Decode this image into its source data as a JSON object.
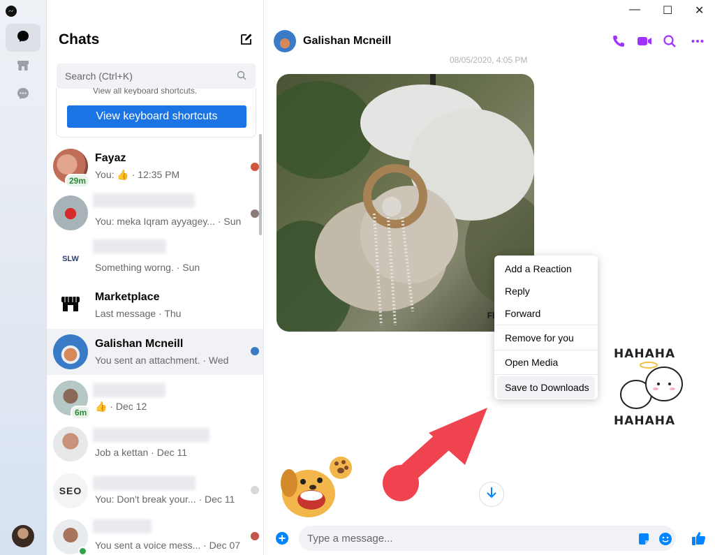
{
  "window": {
    "minimize": "—",
    "maximize": "☐",
    "close": "✕"
  },
  "list": {
    "title": "Chats",
    "search_placeholder": "Search (Ctrl+K)",
    "tip_text": "View all keyboard shortcuts.",
    "tip_button": "View keyboard shortcuts",
    "chats": [
      {
        "name": "Fayaz",
        "preview": "You: 👍 · 12:35 PM",
        "badge": "29m"
      },
      {
        "name": "",
        "preview": "You: meka Iqram ayyagey... · Sun"
      },
      {
        "name": "",
        "preview": "Something worng. · Sun",
        "logo": "SLW"
      },
      {
        "name": "Marketplace",
        "preview": "Last message · Thu"
      },
      {
        "name": "Galishan Mcneill",
        "preview": "You sent an attachment. · Wed"
      },
      {
        "name": "",
        "preview": "👍 · Dec 12",
        "badge": "6m"
      },
      {
        "name": "",
        "preview": "Job a kettan · Dec 11"
      },
      {
        "name": "",
        "preview": "You: Don't break your... · Dec 11",
        "logo": "SEO"
      },
      {
        "name": "",
        "preview": "You sent a voice mess... · Dec 07"
      }
    ]
  },
  "conversation": {
    "contact_name": "Galishan Mcneill",
    "timestamp": "08/05/2020, 4:05 PM",
    "image_watermark": "Fb/Mongo",
    "context_menu": [
      "Add a Reaction",
      "Reply",
      "Forward",
      "Remove for you",
      "Open Media",
      "Save to Downloads"
    ],
    "sticker_text_top": "HAHAHA",
    "sticker_text_bottom": "HAHAHA",
    "composer_placeholder": "Type a message..."
  },
  "colors": {
    "accent": "#a033ff",
    "blue": "#0084ff",
    "button_blue": "#1b74e4",
    "arrow_red": "#ef4350"
  }
}
